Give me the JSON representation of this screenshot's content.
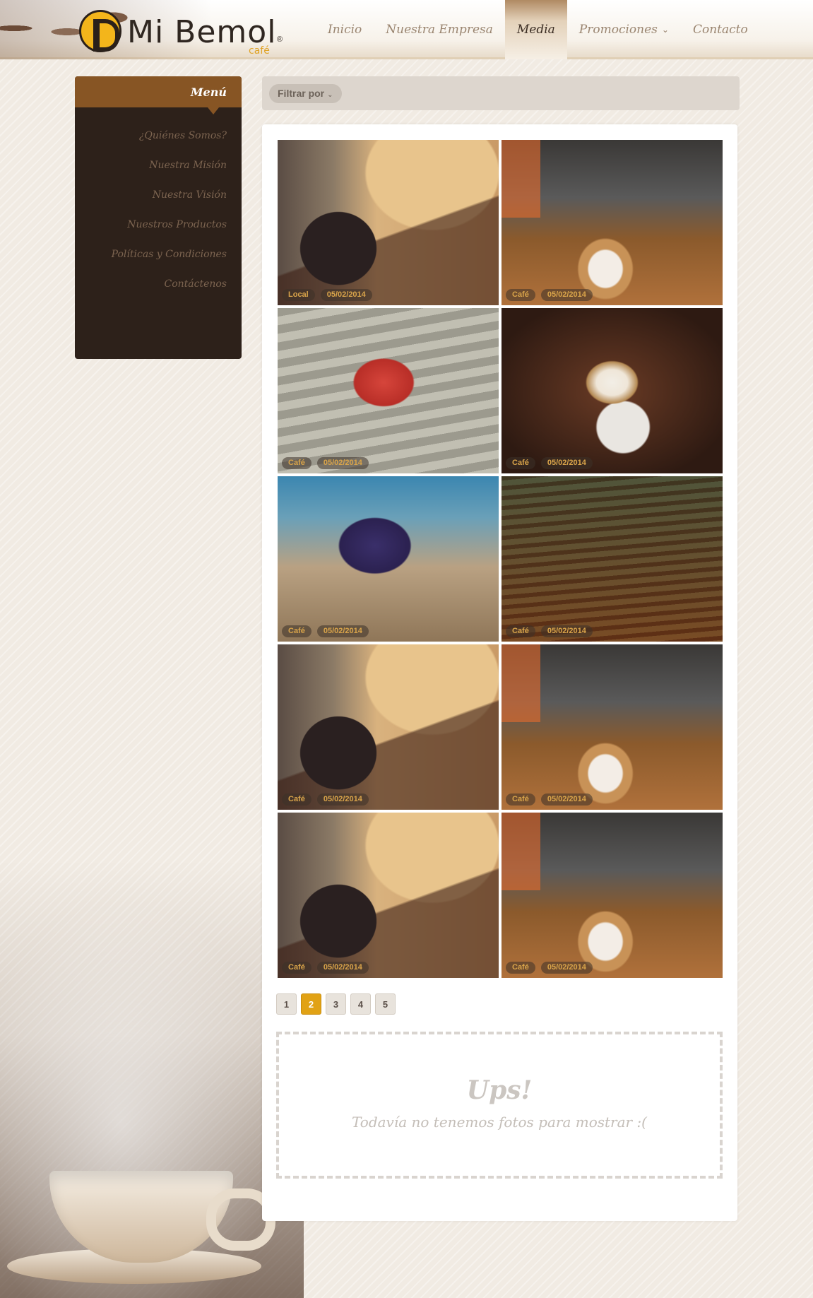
{
  "header": {
    "brand": "Mi Bemol",
    "brand_sub": "café",
    "brand_reg": "®",
    "nav": [
      {
        "label": "Inicio"
      },
      {
        "label": "Nuestra Empresa"
      },
      {
        "label": "Media",
        "active": true
      },
      {
        "label": "Promociones",
        "has_dropdown": true
      },
      {
        "label": "Contacto"
      }
    ]
  },
  "sidebar": {
    "title": "Menú",
    "items": [
      {
        "label": "¿Quiénes Somos?"
      },
      {
        "label": "Nuestra Misión"
      },
      {
        "label": "Nuestra Visión"
      },
      {
        "label": "Nuestros Productos"
      },
      {
        "label": "Políticas y Condiciones"
      },
      {
        "label": "Contáctenos"
      }
    ]
  },
  "filter": {
    "label": "Filtrar por",
    "icon": "chevron-down-icon"
  },
  "gallery": {
    "photos": [
      {
        "category": "Local",
        "date": "05/02/2014",
        "scene": "local"
      },
      {
        "category": "Café",
        "date": "05/02/2014",
        "scene": "coffee"
      },
      {
        "category": "Café",
        "date": "05/02/2014",
        "scene": "red"
      },
      {
        "category": "Café",
        "date": "05/02/2014",
        "scene": "latte"
      },
      {
        "category": "Café",
        "date": "05/02/2014",
        "scene": "purple"
      },
      {
        "category": "Café",
        "date": "05/02/2014",
        "scene": "cake"
      },
      {
        "category": "Café",
        "date": "05/02/2014",
        "scene": "local"
      },
      {
        "category": "Café",
        "date": "05/02/2014",
        "scene": "coffee"
      },
      {
        "category": "Café",
        "date": "05/02/2014",
        "scene": "local"
      },
      {
        "category": "Café",
        "date": "05/02/2014",
        "scene": "coffee"
      }
    ]
  },
  "pagination": {
    "pages": [
      "1",
      "2",
      "3",
      "4",
      "5"
    ],
    "current": "2"
  },
  "empty_state": {
    "title": "Ups!",
    "message": "Todavía no tenemos fotos para mostrar :("
  },
  "colors": {
    "accent": "#e1a215",
    "sidebar_bg": "#2d211a",
    "sidebar_head": "#875524"
  }
}
